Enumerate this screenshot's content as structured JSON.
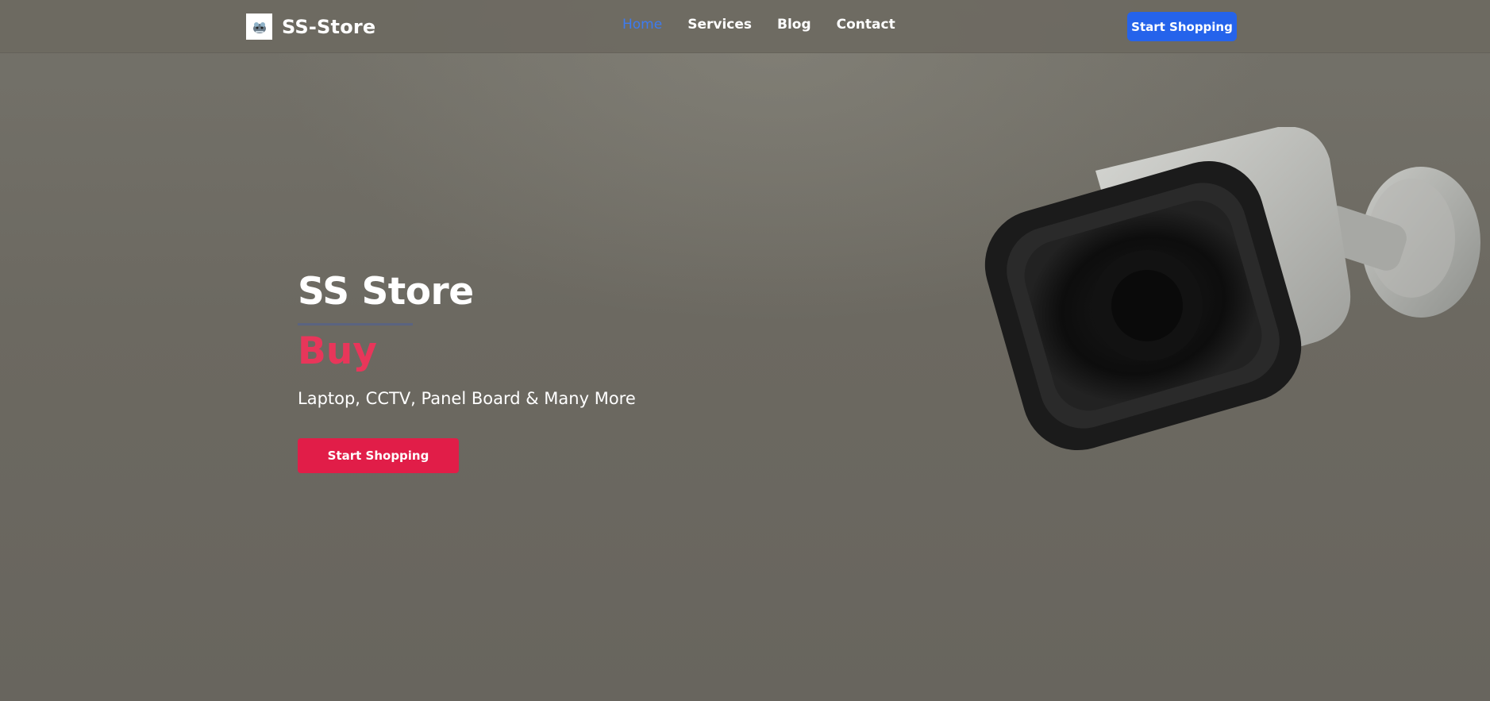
{
  "navbar": {
    "brand": "SS-Store",
    "links": [
      "Home",
      "Services",
      "Blog",
      "Contact"
    ],
    "active_link": "Home",
    "cta_label": "Start Shopping"
  },
  "hero": {
    "title": "SS Store",
    "accent": "Buy",
    "subtitle": "Laptop, CCTV, Panel Board & Many More",
    "cta_label": "Start Shopping"
  },
  "icons": {
    "brand_logo": "store-logo-icon",
    "hero_image": "cctv-camera-image"
  },
  "colors": {
    "nav_active": "#3d7bf0",
    "nav_cta": "#2563eb",
    "accent_text": "#e8365a",
    "hero_cta": "#e11d48"
  }
}
